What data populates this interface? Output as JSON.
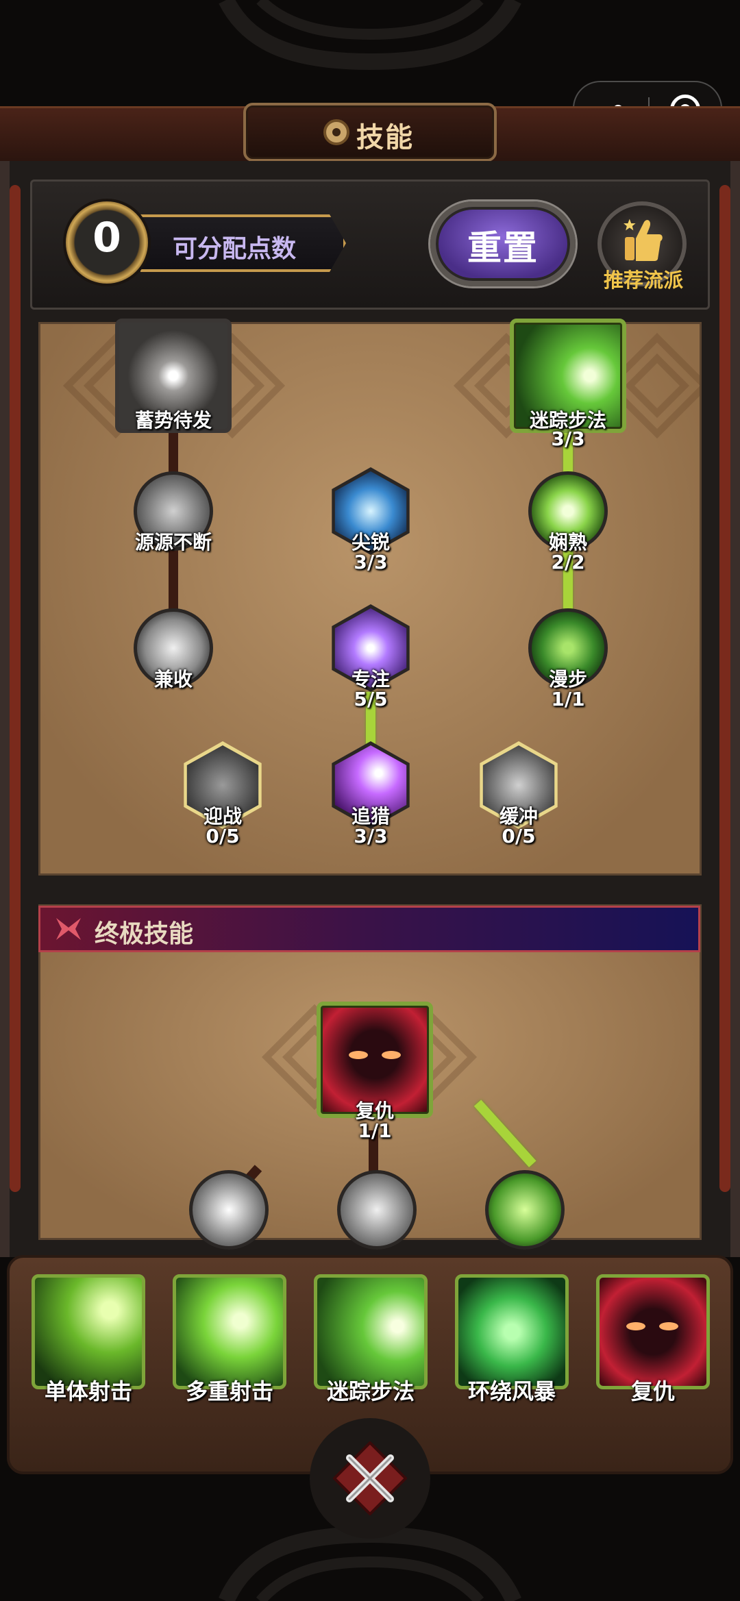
{
  "capsule": {
    "more_icon": "ellipsis-icon",
    "close_icon": "target-close-icon"
  },
  "title": {
    "text": "技能",
    "icon": "wheel-icon"
  },
  "header": {
    "points_value": "0",
    "points_label": "可分配点数",
    "reset_label": "重置",
    "recommend_label": "推荐流派"
  },
  "tree": {
    "xujiao": {
      "name": "蓄势待发"
    },
    "mizong_top": {
      "name": "迷踪步法",
      "level": "3/3"
    },
    "yuanyuan": {
      "name": "源源不断"
    },
    "jianrui": {
      "name": "尖锐",
      "level": "3/3"
    },
    "xianshu": {
      "name": "娴熟",
      "level": "2/2"
    },
    "jianshou": {
      "name": "兼收"
    },
    "zhuanzhu": {
      "name": "专注",
      "level": "5/5"
    },
    "manbu": {
      "name": "漫步",
      "level": "1/1"
    },
    "yingzhan": {
      "name": "迎战",
      "level": "0/5"
    },
    "zhuilie": {
      "name": "追猎",
      "level": "3/3"
    },
    "huanchong": {
      "name": "缓冲",
      "level": "0/5"
    }
  },
  "ultimate": {
    "section_title": "终极技能",
    "fuchou": {
      "name": "复仇",
      "level": "1/1"
    }
  },
  "quickbar": [
    {
      "name": "单体射击",
      "icon": "arrow-shot-icon"
    },
    {
      "name": "多重射击",
      "icon": "multi-shot-icon"
    },
    {
      "name": "迷踪步法",
      "icon": "dash-icon"
    },
    {
      "name": "环绕风暴",
      "icon": "whirlwind-icon"
    },
    {
      "name": "复仇",
      "icon": "shadow-face-icon"
    }
  ],
  "colors": {
    "lit": "#a8d43a",
    "unlit": "#3a1b12",
    "gold": "#f0c44a",
    "purple_button": "#6c4cc0",
    "section_red": "#6b1530",
    "section_blue": "#161256"
  }
}
